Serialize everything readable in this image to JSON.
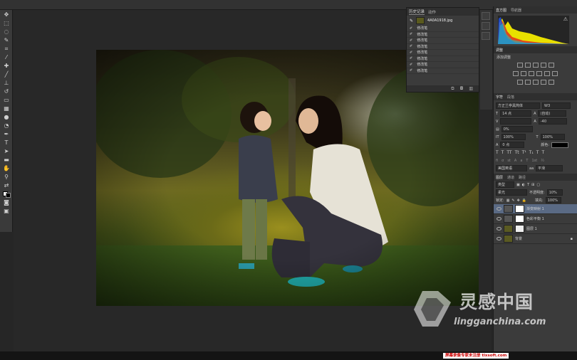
{
  "history_panel": {
    "tabs": [
      "历史记录",
      "动作"
    ],
    "snapshot_name": "4A0A1918.jpg",
    "states": [
      "修改笔",
      "修改笔",
      "修改笔",
      "修改笔",
      "修改笔",
      "修改笔",
      "修改笔",
      "修改笔"
    ]
  },
  "histogram_panel": {
    "tabs": [
      "直方图",
      "导航器"
    ],
    "warning": "⚠"
  },
  "adjustments_panel": {
    "tab": "调整",
    "label": "添加调整"
  },
  "character_panel": {
    "tabs": [
      "字符",
      "段落"
    ],
    "font_family": "方正兰亭黑简体",
    "font_style": "W3",
    "font_size": "14 点",
    "leading": "(自动)",
    "tracking": "-40",
    "kerning": "0%",
    "vertical_scale": "100%",
    "horizontal_scale": "100%",
    "baseline": "0 点",
    "color_label": "颜色:",
    "language": "美国英语",
    "antialias": "平滑",
    "aa_symbol": "aa"
  },
  "layers_panel": {
    "tabs": [
      "图层",
      "通道",
      "路径"
    ],
    "kind": "类型",
    "blend_mode": "柔光",
    "opacity_label": "不透明度:",
    "opacity": "10%",
    "lock_label": "锁定:",
    "fill_label": "填充:",
    "fill": "100%",
    "layers": [
      {
        "name": "渐变映射 1",
        "selected": true
      },
      {
        "name": "色彩平衡 1",
        "selected": false
      },
      {
        "name": "图层 1",
        "selected": false
      },
      {
        "name": "背景",
        "selected": false
      }
    ]
  },
  "watermark": {
    "cn": "灵感中国",
    "en": "lingganchina.com"
  },
  "credit": "屏幕录像专家未注册 tlxsoft.com"
}
